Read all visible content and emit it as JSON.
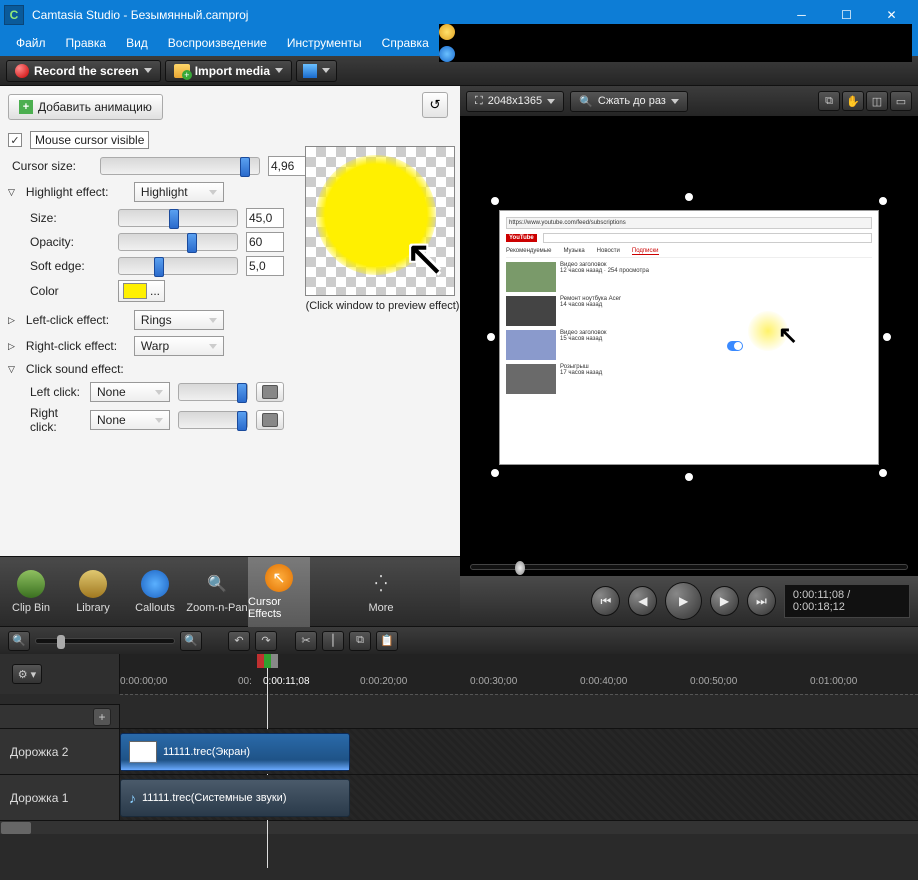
{
  "titlebar": {
    "title": "Camtasia Studio - Безымянный.camproj"
  },
  "menu": {
    "file": "Файл",
    "edit": "Правка",
    "view": "Вид",
    "play": "Воспроизведение",
    "tools": "Инструменты",
    "help": "Справка"
  },
  "toolbar": {
    "record": "Record the screen",
    "import": "Import media"
  },
  "panel": {
    "add_animation": "Добавить анимацию",
    "mouse_visible": "Mouse cursor visible",
    "cursor_size": "Cursor size:",
    "cursor_size_val": "4,96",
    "highlight": "Highlight effect:",
    "highlight_sel": "Highlight",
    "size": "Size:",
    "size_val": "45,0",
    "opacity": "Opacity:",
    "opacity_val": "60",
    "soft_edge": "Soft edge:",
    "soft_val": "5,0",
    "color": "Color",
    "left_effect": "Left-click effect:",
    "left_sel": "Rings",
    "right_effect": "Right-click effect:",
    "right_sel": "Warp",
    "sound_effect": "Click sound effect:",
    "left_click": "Left click:",
    "left_click_sel": "None",
    "right_click": "Right click:",
    "right_click_sel": "None",
    "preview_caption": "(Click window to preview effect)"
  },
  "tabs": {
    "clip_bin": "Clip Bin",
    "library": "Library",
    "callouts": "Callouts",
    "zoom": "Zoom-n-Pan",
    "cursor": "Cursor Effects",
    "more": "More"
  },
  "preview": {
    "dimensions": "2048x1365",
    "shrink": "Сжать до раз",
    "time": "0:00:11;08 / 0:00:18;12"
  },
  "timeline": {
    "playhead": "0:00:11;08",
    "stamps": [
      "0:00:00;00",
      "00:",
      "0:00:20;00",
      "0:00:30;00",
      "0:00:40;00",
      "0:00:50;00",
      "0:01:00;00"
    ],
    "track2": "Дорожка 2",
    "track1": "Дорожка 1",
    "clip_video": "11111.trec(Экран)",
    "clip_audio": "11111.trec(Системные звуки)"
  }
}
